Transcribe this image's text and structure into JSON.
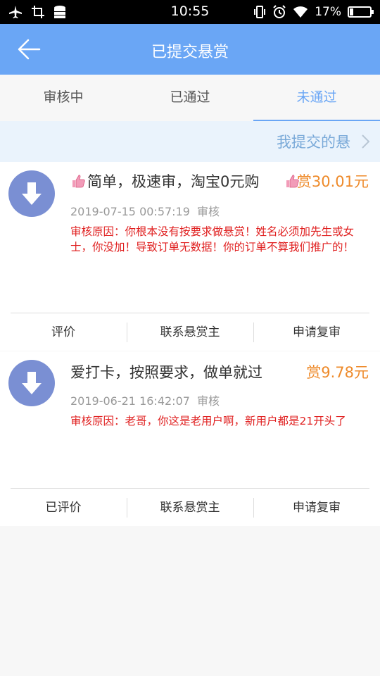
{
  "status_bar": {
    "time": "10:55",
    "battery": "17%",
    "battery_level": 0.17,
    "left_icons": [
      "airplane-icon",
      "screenshot-icon",
      "storage-icon"
    ],
    "right_icons": [
      "vibrate-icon",
      "alarm-icon",
      "wifi-icon",
      "battery-icon"
    ]
  },
  "header": {
    "title": "已提交悬赏",
    "back_icon": "back-arrow-icon"
  },
  "tabs": [
    {
      "label": "审核中",
      "active": false
    },
    {
      "label": "已通过",
      "active": false
    },
    {
      "label": "未通过",
      "active": true
    }
  ],
  "banner": {
    "text": "我提交的悬",
    "chevron_icon": "chevron-right-icon"
  },
  "colors": {
    "header": "#6aa6f5",
    "active_tab": "#6aa6f5",
    "price": "#ee8a2a",
    "reason": "#e02020",
    "icon_bg": "#7a8fd3"
  },
  "items": [
    {
      "icon": "download-icon",
      "title_prefix_icon": "thumbs-up-icon",
      "title": "简单，极速审，淘宝0元购",
      "price_icon": "thumbs-up-icon",
      "price": "赏30.01元",
      "date": "2019-07-15 00:57:19",
      "status": "审核",
      "reason": "审核原因：你根本没有按要求做悬赏！姓名必须加先生或女士，你没加！导致订单无数据！你的订单不算我们推广的！",
      "actions": [
        "评价",
        "联系悬赏主",
        "申请复审"
      ]
    },
    {
      "icon": "download-icon",
      "title": "爱打卡，按照要求，做单就过",
      "price": "赏9.78元",
      "date": "2019-06-21 16:42:07",
      "status": "审核",
      "reason": "审核原因：老哥，你这是老用户啊，新用户都是21开头了",
      "actions": [
        "已评价",
        "联系悬赏主",
        "申请复审"
      ]
    }
  ]
}
